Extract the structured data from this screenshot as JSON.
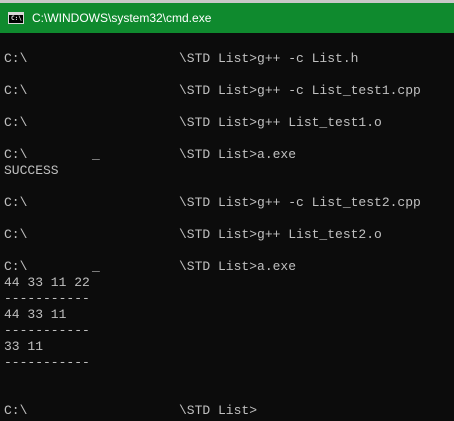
{
  "window": {
    "title": "C:\\WINDOWS\\system32\\cmd.exe",
    "titlebar_color": "#0f8a2e",
    "icon": "cmd-console-icon",
    "icon_glyph": "C:\\"
  },
  "console": {
    "line_01": "",
    "line_02_drive": "C:\\",
    "line_02_cmd": "\\STD List>g++ -c List.h",
    "line_03": "",
    "line_04_drive": "C:\\",
    "line_04_cmd": "\\STD List>g++ -c List_test1.cpp",
    "line_05": "",
    "line_06_drive": "C:\\",
    "line_06_cmd": "\\STD List>g++ List_test1.o",
    "line_07": "",
    "line_08_drive": "C:\\",
    "line_08_mark": "_",
    "line_08_cmd": "\\STD List>a.exe",
    "line_09": "SUCCESS",
    "line_10": "",
    "line_11_drive": "C:\\",
    "line_11_cmd": "\\STD List>g++ -c List_test2.cpp",
    "line_12": "",
    "line_13_drive": "C:\\",
    "line_13_cmd": "\\STD List>g++ List_test2.o",
    "line_14": "",
    "line_15_drive": "C:\\",
    "line_15_mark": "_",
    "line_15_cmd": "\\STD List>a.exe",
    "line_16": "44 33 11 22",
    "line_17": "-----------",
    "line_18": "44 33 11",
    "line_19": "-----------",
    "line_20": "33 11",
    "line_21": "-----------",
    "line_22": "",
    "line_23": "",
    "line_24_drive": "C:\\",
    "line_24_cmd": "\\STD List>"
  }
}
